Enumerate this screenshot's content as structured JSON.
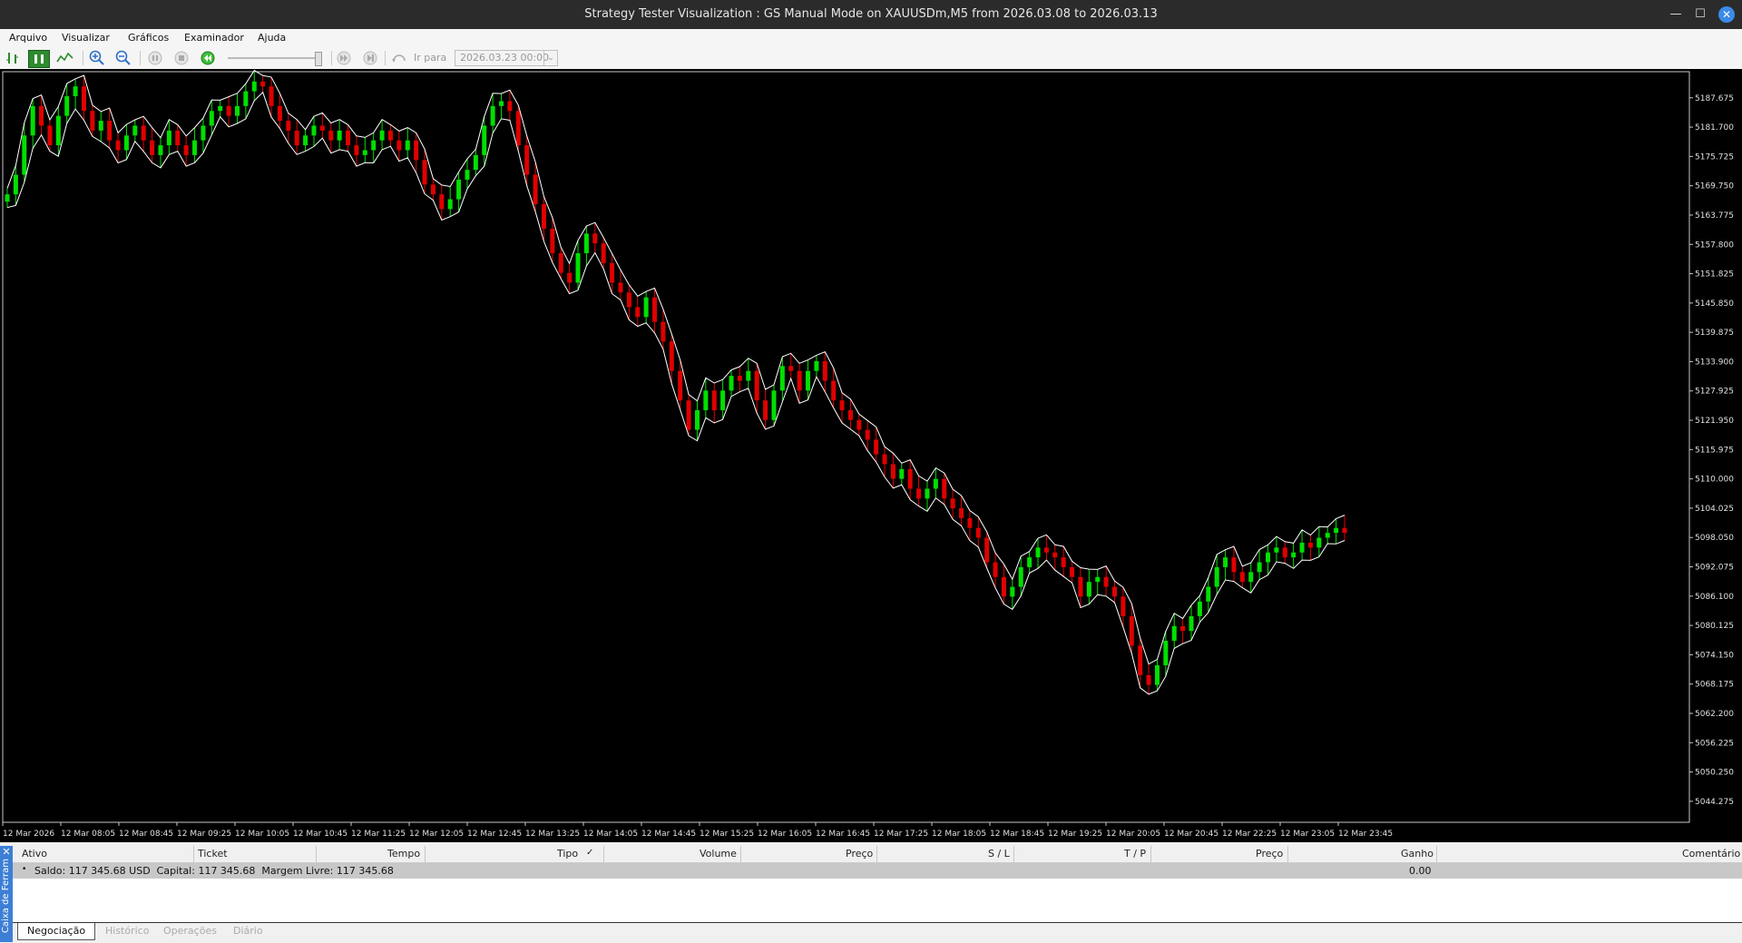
{
  "window": {
    "title": "Strategy Tester Visualization : GS Manual Mode on XAUUSDm,M5 from 2026.03.08 to 2026.03.13"
  },
  "menu": [
    "Arquivo",
    "Visualizar",
    "Gráficos",
    "Examinador",
    "Ajuda"
  ],
  "toolbar": {
    "goto_label": "Ir para",
    "date_value": "2026.03.23 00:00"
  },
  "chart_data": {
    "type": "candlestick",
    "symbol": "XAUUSDm",
    "timeframe": "M5",
    "ylim": [
      5040,
      5193
    ],
    "y_ticks": [
      "5187.675",
      "5181.700",
      "5175.725",
      "5169.750",
      "5163.775",
      "5157.800",
      "5151.825",
      "5145.850",
      "5139.875",
      "5133.900",
      "5127.925",
      "5121.950",
      "5115.975",
      "5110.000",
      "5104.025",
      "5098.050",
      "5092.075",
      "5086.100",
      "5080.125",
      "5074.150",
      "5068.175",
      "5062.200",
      "5056.225",
      "5050.250",
      "5044.275"
    ],
    "x_ticks": [
      "12 Mar 2026",
      "12 Mar 08:05",
      "12 Mar 08:45",
      "12 Mar 09:25",
      "12 Mar 10:05",
      "12 Mar 10:45",
      "12 Mar 11:25",
      "12 Mar 12:05",
      "12 Mar 12:45",
      "12 Mar 13:25",
      "12 Mar 14:05",
      "12 Mar 14:45",
      "12 Mar 15:25",
      "12 Mar 16:05",
      "12 Mar 16:45",
      "12 Mar 17:25",
      "12 Mar 18:05",
      "12 Mar 18:45",
      "12 Mar 19:25",
      "12 Mar 20:05",
      "12 Mar 20:45",
      "12 Mar 22:25",
      "12 Mar 23:05",
      "12 Mar 23:45"
    ],
    "close_path": [
      5168,
      5172,
      5180,
      5186,
      5182,
      5178,
      5184,
      5188,
      5190,
      5185,
      5181,
      5183,
      5179,
      5177,
      5180,
      5182,
      5179,
      5176,
      5178,
      5181,
      5178,
      5176,
      5179,
      5182,
      5185,
      5186,
      5184,
      5186,
      5189,
      5191,
      5190,
      5186,
      5183,
      5181,
      5178,
      5180,
      5182,
      5181,
      5179,
      5181,
      5178,
      5176,
      5177,
      5179,
      5181,
      5179,
      5177,
      5179,
      5175,
      5170,
      5168,
      5165,
      5167,
      5171,
      5173,
      5176,
      5182,
      5186,
      5187,
      5185,
      5178,
      5172,
      5166,
      5161,
      5156,
      5152,
      5150,
      5156,
      5160,
      5158,
      5154,
      5150,
      5148,
      5145,
      5143,
      5147,
      5142,
      5138,
      5132,
      5126,
      5120,
      5124,
      5128,
      5124,
      5128,
      5131,
      5130,
      5132,
      5126,
      5122,
      5128,
      5133,
      5132,
      5128,
      5132,
      5134,
      5130,
      5126,
      5124,
      5122,
      5120,
      5118,
      5115,
      5113,
      5110,
      5112,
      5108,
      5106,
      5108,
      5110,
      5106,
      5104,
      5102,
      5100,
      5098,
      5093,
      5090,
      5086,
      5088,
      5092,
      5094,
      5096,
      5095,
      5094,
      5092,
      5090,
      5086,
      5089,
      5090,
      5088,
      5086,
      5082,
      5076,
      5070,
      5068,
      5072,
      5077,
      5080,
      5079,
      5082,
      5085,
      5088,
      5092,
      5094,
      5091,
      5089,
      5091,
      5093,
      5095,
      5096,
      5094,
      5095,
      5097,
      5096,
      5098,
      5099,
      5100,
      5099
    ],
    "background": "#000000",
    "up_color": "#00e000",
    "down_color": "#e00000",
    "wick_color": "#ffffff"
  },
  "terminal": {
    "columns": [
      "Ativo",
      "Ticket",
      "Tempo",
      "Tipo",
      "Volume",
      "Preço",
      "S / L",
      "T / P",
      "Preço",
      "Ganho",
      "Comentário"
    ],
    "summary": "Saldo: 117 345.68 USD  Capital: 117 345.68  Margem Livre: 117 345.68",
    "profit": "0.00"
  },
  "tabs": [
    "Negociação",
    "Histórico",
    "Operações",
    "Diário"
  ],
  "sidebar": {
    "label": "Caixa de Ferram",
    "close": "✕"
  },
  "window_controls": {
    "minimize": "—",
    "maximize": "☐",
    "close": "✕"
  }
}
